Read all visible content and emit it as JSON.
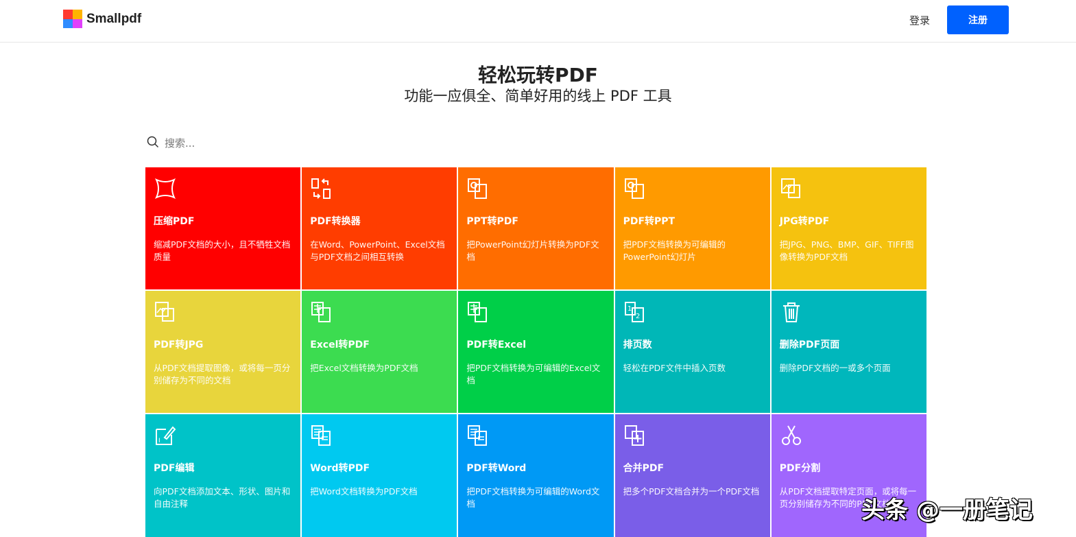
{
  "header": {
    "logo_text": "Smallpdf",
    "login": "登录",
    "signup": "注册"
  },
  "hero": {
    "title": "轻松玩转PDF",
    "subtitle": "功能一应俱全、简单好用的线上 PDF 工具"
  },
  "search": {
    "placeholder": "搜索..."
  },
  "tools": [
    {
      "name": "压缩PDF",
      "desc": "缩减PDF文档的大小，且不牺牲文档质量",
      "color": "#ff0000",
      "icon": "compress-icon"
    },
    {
      "name": "PDF转换器",
      "desc": "在Word、PowerPoint、Excel文档与PDF文档之间相互转换",
      "color": "#ff3d00",
      "icon": "convert-icon"
    },
    {
      "name": "PPT转PDF",
      "desc": "把PowerPoint幻灯片转换为PDF文档",
      "color": "#ff6d00",
      "icon": "ppt-icon"
    },
    {
      "name": "PDF转PPT",
      "desc": "把PDF文档转换为可编辑的PowerPoint幻灯片",
      "color": "#ff9a00",
      "icon": "ppt-icon"
    },
    {
      "name": "JPG转PDF",
      "desc": "把JPG、PNG、BMP、GIF、TIFF图像转换为PDF文档",
      "color": "#f5c20f",
      "icon": "image-icon"
    },
    {
      "name": "PDF转JPG",
      "desc": "从PDF文档提取图像，或将每一页分别储存为不同的文档",
      "color": "#e8d53c",
      "icon": "image-icon"
    },
    {
      "name": "Excel转PDF",
      "desc": "把Excel文档转换为PDF文档",
      "color": "#3cdc50",
      "icon": "excel-icon"
    },
    {
      "name": "PDF转Excel",
      "desc": "把PDF文档转换为可编辑的Excel文档",
      "color": "#00cf48",
      "icon": "excel-icon"
    },
    {
      "name": "排页数",
      "desc": "轻松在PDF文件中插入页数",
      "color": "#00b7b7",
      "icon": "page-numbers-icon"
    },
    {
      "name": "删除PDF页面",
      "desc": "删除PDF文档的一或多个页面",
      "color": "#00b7bc",
      "icon": "trash-icon"
    },
    {
      "name": "PDF编辑",
      "desc": "向PDF文档添加文本、形状、图片和自由注释",
      "color": "#00c3c8",
      "icon": "edit-icon"
    },
    {
      "name": "Word转PDF",
      "desc": "把Word文档转换为PDF文档",
      "color": "#00c9f0",
      "icon": "word-icon"
    },
    {
      "name": "PDF转Word",
      "desc": "把PDF文档转换为可编辑的Word文档",
      "color": "#0099f5",
      "icon": "word-icon"
    },
    {
      "name": "合并PDF",
      "desc": "把多个PDF文档合并为一个PDF文档",
      "color": "#7a5ee8",
      "icon": "merge-icon"
    },
    {
      "name": "PDF分割",
      "desc": "从PDF文档提取特定页面，或将每一页分别储存为不同的PDF文档",
      "color": "#a066fd",
      "icon": "scissors-icon"
    }
  ],
  "watermark": "头条 @一册笔记"
}
